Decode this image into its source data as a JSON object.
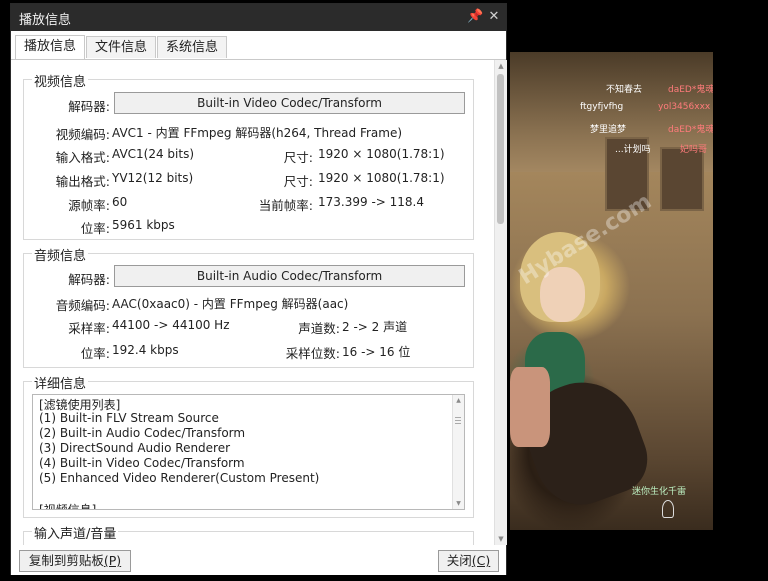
{
  "window": {
    "title": "播放信息",
    "pin_icon": "pin-icon",
    "close_icon": "close-icon"
  },
  "tabs": [
    {
      "label": "播放信息",
      "active": true
    },
    {
      "label": "文件信息",
      "active": false
    },
    {
      "label": "系统信息",
      "active": false
    }
  ],
  "video_info": {
    "title": "视频信息",
    "decoder_label": "解码器:",
    "decoder_button": "Built-in Video Codec/Transform",
    "codec_label": "视频编码:",
    "codec_value": "AVC1 - 内置 FFmpeg 解码器(h264, Thread Frame)",
    "input_format_label": "输入格式:",
    "input_format_value": "AVC1(24 bits)",
    "input_size_label": "尺寸:",
    "input_size_value": "1920 × 1080(1.78:1)",
    "output_format_label": "输出格式:",
    "output_format_value": "YV12(12 bits)",
    "output_size_label": "尺寸:",
    "output_size_value": "1920 × 1080(1.78:1)",
    "source_fps_label": "源帧率:",
    "source_fps_value": "60",
    "current_fps_label": "当前帧率:",
    "current_fps_value": "173.399 -> 118.4",
    "bitrate_label": "位率:",
    "bitrate_value": "5961 kbps"
  },
  "audio_info": {
    "title": "音频信息",
    "decoder_label": "解码器:",
    "decoder_button": "Built-in Audio Codec/Transform",
    "codec_label": "音频编码:",
    "codec_value": "AAC(0xaac0) - 内置 FFmpeg 解码器(aac)",
    "samplerate_label": "采样率:",
    "samplerate_value": "44100 -> 44100 Hz",
    "channels_label": "声道数:",
    "channels_value": "2 -> 2 声道",
    "bitrate_label": "位率:",
    "bitrate_value": "192.4 kbps",
    "bitdepth_label": "采样位数:",
    "bitdepth_value": "16 -> 16 位"
  },
  "details": {
    "title": "详细信息",
    "lines": [
      "[滤镜使用列表]",
      "(1) Built-in FLV Stream Source",
      "(2) Built-in Audio Codec/Transform",
      "(3) DirectSound Audio Renderer",
      "(4) Built-in Video Codec/Transform",
      "(5) Enhanced Video Renderer(Custom Present)",
      "",
      "[视频信息]"
    ]
  },
  "input_channel": {
    "title": "输入声道/音量"
  },
  "buttons": {
    "copy_label": "复制到剪贴板",
    "copy_hotkey": "(P)",
    "close_label": "关闭",
    "close_hotkey": "(C)"
  },
  "video_overlay": {
    "kill_feed": [
      {
        "killer": "不知春去",
        "victim": "daED*鬼魂"
      },
      {
        "killer": "ftgyfjvfhg",
        "victim": "yol3456xxx"
      },
      {
        "killer": "梦里追梦",
        "victim": "daED*鬼魂"
      },
      {
        "killer": "...计划吗",
        "victim": "妃吗哥"
      }
    ],
    "player_name": "迷你生化千雷",
    "watermark": "Hybase.com"
  },
  "colors": {
    "titlebar": "#2b2b2b",
    "dialog_bg": "#ffffff",
    "button_bg": "#f0f0f0"
  }
}
